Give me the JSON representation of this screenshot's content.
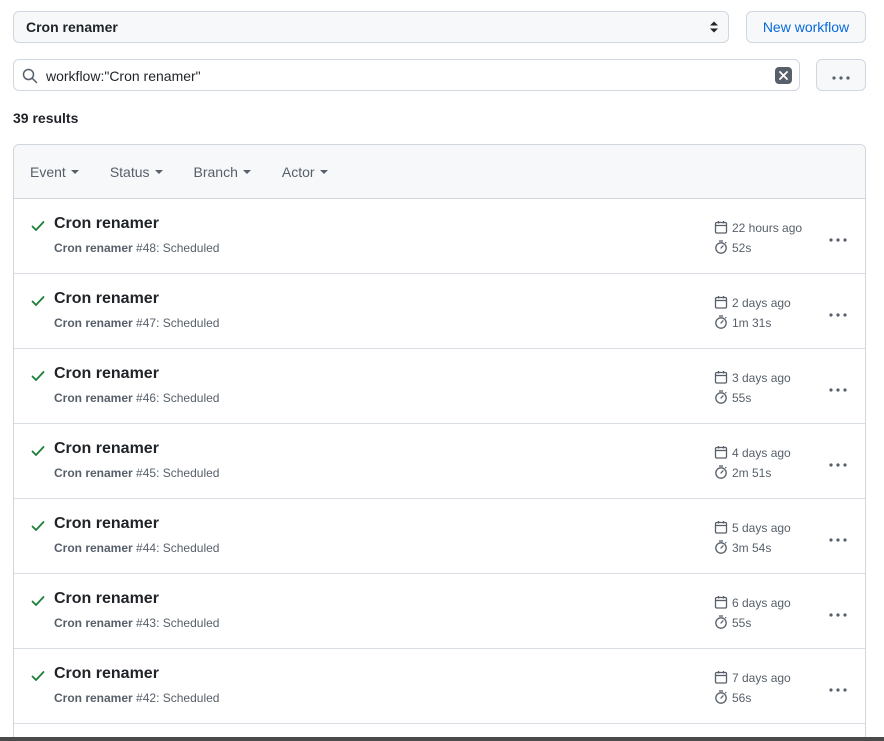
{
  "workflow_select": {
    "label": "Cron renamer"
  },
  "new_workflow_button": "New workflow",
  "search": {
    "query": "workflow:\"Cron renamer\""
  },
  "results_count": "39 results",
  "filters": [
    "Event",
    "Status",
    "Branch",
    "Actor"
  ],
  "runs": [
    {
      "title": "Cron renamer",
      "workflow": "Cron renamer",
      "run_number": "#48",
      "event": ": Scheduled",
      "when": "22 hours ago",
      "duration": "52s",
      "status": "success"
    },
    {
      "title": "Cron renamer",
      "workflow": "Cron renamer",
      "run_number": "#47",
      "event": ": Scheduled",
      "when": "2 days ago",
      "duration": "1m 31s",
      "status": "success"
    },
    {
      "title": "Cron renamer",
      "workflow": "Cron renamer",
      "run_number": "#46",
      "event": ": Scheduled",
      "when": "3 days ago",
      "duration": "55s",
      "status": "success"
    },
    {
      "title": "Cron renamer",
      "workflow": "Cron renamer",
      "run_number": "#45",
      "event": ": Scheduled",
      "when": "4 days ago",
      "duration": "2m 51s",
      "status": "success"
    },
    {
      "title": "Cron renamer",
      "workflow": "Cron renamer",
      "run_number": "#44",
      "event": ": Scheduled",
      "when": "5 days ago",
      "duration": "3m 54s",
      "status": "success"
    },
    {
      "title": "Cron renamer",
      "workflow": "Cron renamer",
      "run_number": "#43",
      "event": ": Scheduled",
      "when": "6 days ago",
      "duration": "55s",
      "status": "success"
    },
    {
      "title": "Cron renamer",
      "workflow": "Cron renamer",
      "run_number": "#42",
      "event": ": Scheduled",
      "when": "7 days ago",
      "duration": "56s",
      "status": "success"
    }
  ],
  "colors": {
    "success": "#1a7f37",
    "link": "#0969da",
    "border": "#d0d7de",
    "muted": "#57606a"
  }
}
